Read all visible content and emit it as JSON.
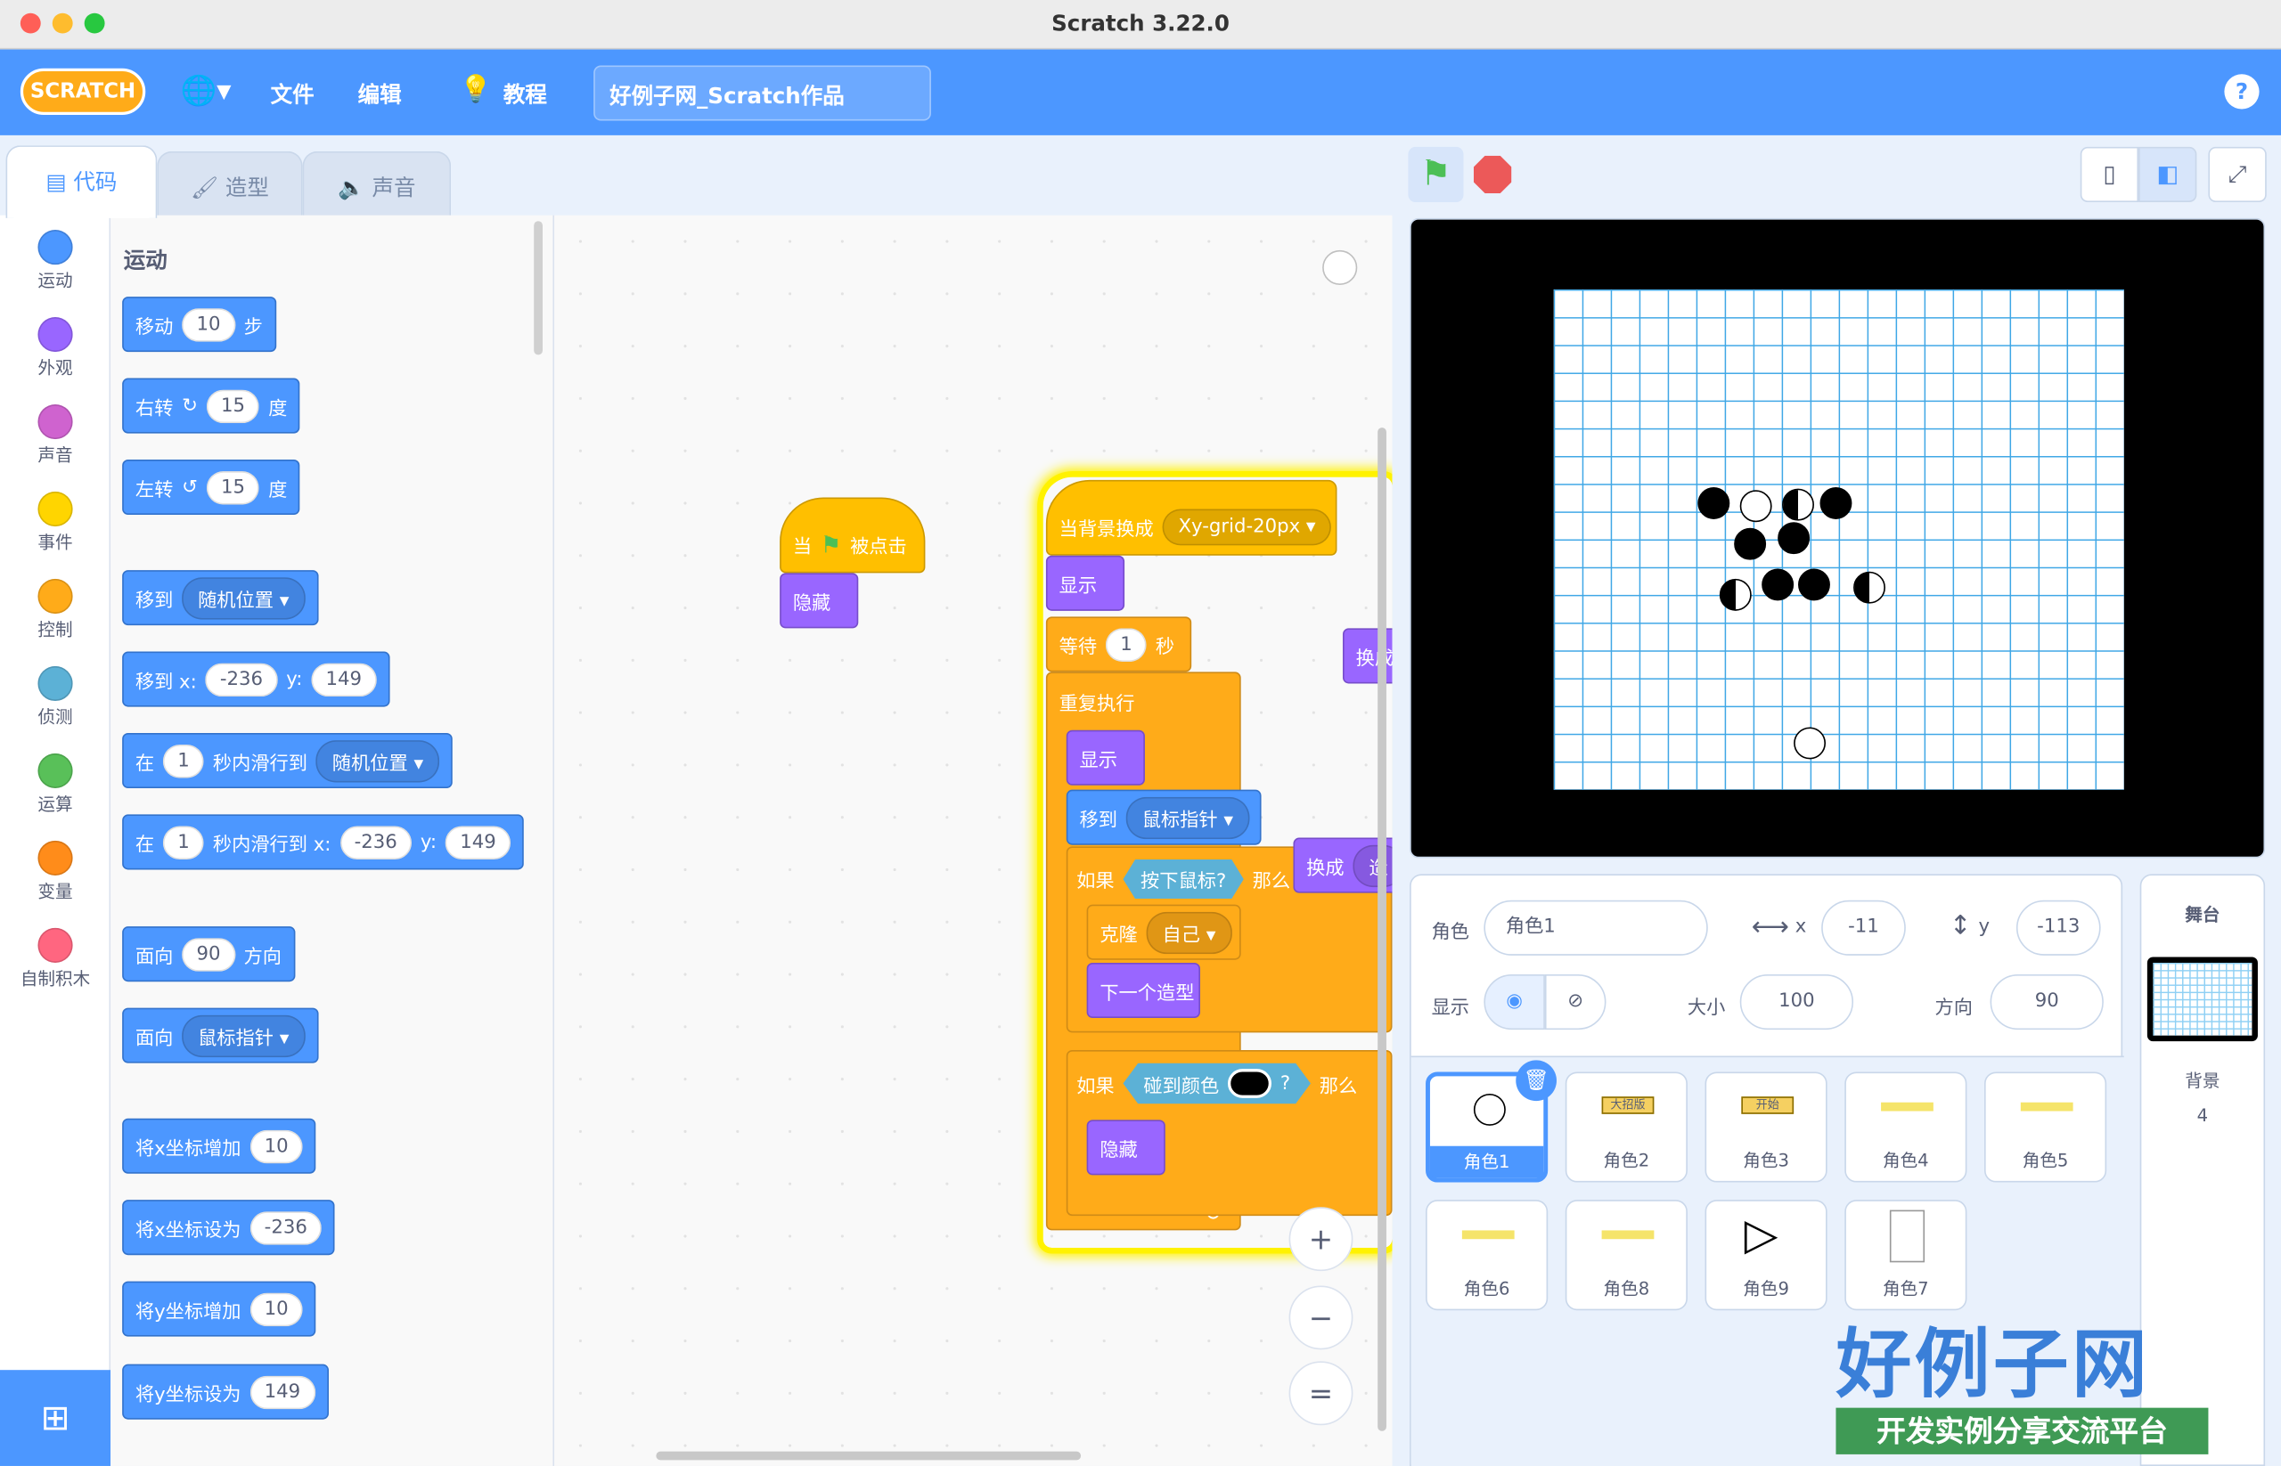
{
  "window": {
    "title": "Scratch 3.22.0"
  },
  "menu": {
    "logo": "SCRATCH",
    "file": "文件",
    "edit": "编辑",
    "tutorials": "教程",
    "project_name": "好例子网_Scratch作品",
    "help": "?"
  },
  "tabs": [
    {
      "label": "代码"
    },
    {
      "label": "造型"
    },
    {
      "label": "声音"
    }
  ],
  "categories": [
    {
      "label": "运动",
      "color": "#4c97ff"
    },
    {
      "label": "外观",
      "color": "#9966ff"
    },
    {
      "label": "声音",
      "color": "#cf63cf"
    },
    {
      "label": "事件",
      "color": "#ffd500"
    },
    {
      "label": "控制",
      "color": "#ffab19"
    },
    {
      "label": "侦测",
      "color": "#5cb1d6"
    },
    {
      "label": "运算",
      "color": "#59c059"
    },
    {
      "label": "变量",
      "color": "#ff8c1a"
    },
    {
      "label": "自制积木",
      "color": "#ff6680"
    }
  ],
  "palette": {
    "heading": "运动",
    "move": {
      "a": "移动",
      "v": "10",
      "b": "步"
    },
    "turn_right": {
      "a": "右转",
      "v": "15",
      "b": "度"
    },
    "turn_left": {
      "a": "左转",
      "v": "15",
      "b": "度"
    },
    "goto": {
      "a": "移到",
      "d": "随机位置"
    },
    "goto_xy": {
      "a": "移到 x:",
      "x": "-236",
      "b": "y:",
      "y": "149"
    },
    "glide": {
      "a": "在",
      "v": "1",
      "b": "秒内滑行到",
      "d": "随机位置"
    },
    "glide_xy": {
      "a": "在",
      "v": "1",
      "b": "秒内滑行到 x:",
      "x": "-236",
      "c": "y:",
      "y": "149"
    },
    "point_dir": {
      "a": "面向",
      "v": "90",
      "b": "方向"
    },
    "point_to": {
      "a": "面向",
      "d": "鼠标指针"
    },
    "change_x": {
      "a": "将x坐标增加",
      "v": "10"
    },
    "set_x": {
      "a": "将x坐标设为",
      "v": "-236"
    },
    "change_y": {
      "a": "将y坐标增加",
      "v": "10"
    },
    "set_y": {
      "a": "将y坐标设为",
      "v": "149"
    }
  },
  "script1": {
    "hat_a": "当",
    "hat_b": "被点击",
    "hide": "隐藏"
  },
  "script2": {
    "hat": "当背景换成",
    "backdrop": "Xy-grid-20px",
    "show": "显示",
    "wait": "等待",
    "wait_v": "1",
    "wait_unit": "秒",
    "forever": "重复执行",
    "show2": "显示",
    "goto": "移到",
    "goto_d": "鼠标指针",
    "if1": "如果",
    "mouse": "按下鼠标?",
    "then1": "那么",
    "clone": "克隆",
    "clone_d": "自己",
    "next": "下一个造型",
    "if2": "如果",
    "touch": "碰到颜色",
    "q": "?",
    "then2": "那么",
    "hide": "隐藏"
  },
  "floating": {
    "switch1": "换成",
    "switch2": "换成",
    "switch2_tail": "造"
  },
  "zoom": {
    "in": "+",
    "out": "−",
    "reset": "="
  },
  "sprite_info": {
    "sprite_label": "角色",
    "sprite_name": "角色1",
    "x_label": "x",
    "x": "-11",
    "y_label": "y",
    "y": "-113",
    "show_label": "显示",
    "size_label": "大小",
    "size": "100",
    "dir_label": "方向",
    "dir": "90"
  },
  "sprites": [
    {
      "name": "角色1",
      "selected": true
    },
    {
      "name": "角色2",
      "badge": "大招版"
    },
    {
      "name": "角色3",
      "badge": "开始"
    },
    {
      "name": "角色4"
    },
    {
      "name": "角色5"
    },
    {
      "name": "角色6"
    },
    {
      "name": "角色8"
    },
    {
      "name": "角色9"
    },
    {
      "name": "角色7"
    }
  ],
  "stage_panel": {
    "title": "舞台",
    "backdrops_label": "背景",
    "backdrops_count": "4"
  },
  "watermark": {
    "main": "好例子网",
    "sub": "开发实例分享交流平台"
  }
}
